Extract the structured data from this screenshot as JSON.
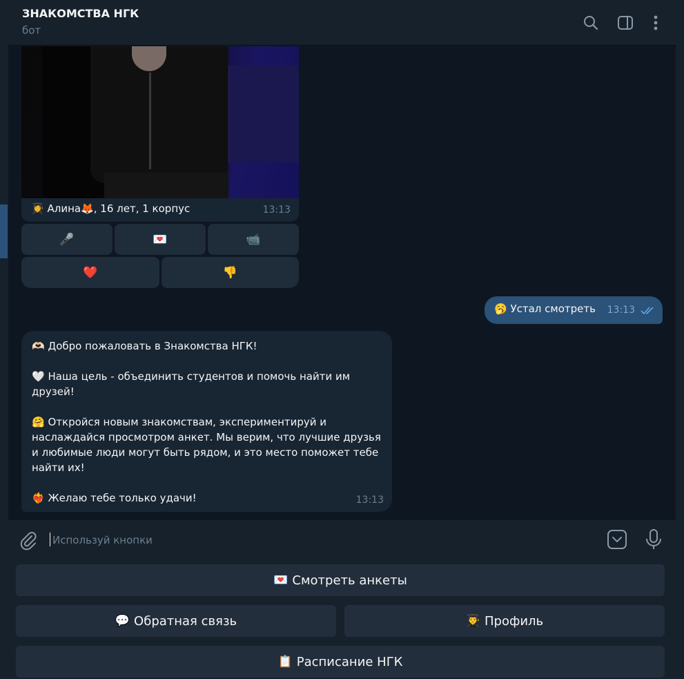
{
  "header": {
    "title": "ЗНАКОМСТВА НГК",
    "subtitle": "бот"
  },
  "photo_message": {
    "caption_emoji_before": "👩‍🎓",
    "caption_name": "Алина",
    "caption_emoji_after": "🦊",
    "caption_rest": ", 16 лет, 1 корпус",
    "time": "13:13",
    "inline_buttons_row1": [
      "🎤",
      "💌",
      "📹"
    ],
    "inline_buttons_row2": [
      "❤️",
      "👎"
    ]
  },
  "outgoing_message": {
    "emoji": "🥱",
    "text": "Устал смотреть",
    "time": "13:13",
    "read": true
  },
  "incoming_message": {
    "line1_emoji": "🫶🏻",
    "line1": "Добро пожаловать в Знакомства НГК!",
    "line2_emoji": "🤍",
    "line2": "Наша цель - объединить студентов и помочь найти им друзей!",
    "line3_emoji": "🤗",
    "line3": "Откройся новым знакомствам, экспериментируй и наслаждайся просмотром анкет. Мы верим, что лучшие друзья и любимые люди могут быть рядом, и это место поможет тебе найти их!",
    "line4_emoji": "❤️‍🔥",
    "line4": "Желаю тебе только удачи!",
    "time": "13:13"
  },
  "composer": {
    "placeholder": "Используй кнопки"
  },
  "reply_keyboard": {
    "browse": {
      "emoji": "💌",
      "label": "Смотреть анкеты"
    },
    "feedback": {
      "emoji": "💬",
      "label": "Обратная связь"
    },
    "profile": {
      "emoji": "👨‍🎓",
      "label": "Профиль"
    },
    "schedule": {
      "emoji": "📋",
      "label": "Расписание НГК"
    }
  },
  "colors": {
    "background": "#0e1621",
    "panel": "#17212b",
    "incoming_bubble": "#182533",
    "outgoing_bubble": "#2b5278",
    "secondary_text": "#6d7f8f",
    "read_check": "#5fa8e8"
  }
}
